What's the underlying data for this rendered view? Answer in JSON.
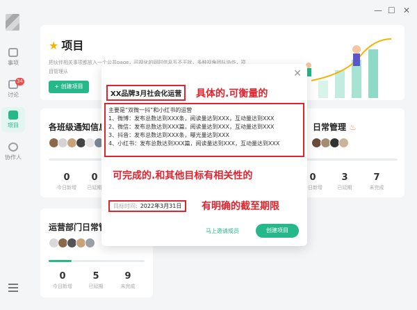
{
  "window": {
    "min": "—",
    "max": "☐",
    "close": "✕"
  },
  "sidebar": {
    "items": [
      {
        "label": "事项"
      },
      {
        "label": "讨论",
        "badge": "34"
      },
      {
        "label": "项目"
      },
      {
        "label": "协作人"
      }
    ]
  },
  "banner": {
    "title": "项目",
    "desc": "把伙伴相关事项都放入一个公共page，可视化的同时信息互不干扰，多种视角团队协作，项目管理从",
    "create_label": "+ 创建项目"
  },
  "cards": [
    {
      "title": "各班级通知信息",
      "stats": [
        {
          "n": "0",
          "t": "今日新增"
        },
        {
          "n": "0",
          "t": "已延期"
        }
      ]
    },
    {
      "title": "日常管理",
      "stats": [
        {
          "n": "0",
          "t": "今日新增"
        },
        {
          "n": "3",
          "t": "已延期"
        },
        {
          "n": "7",
          "t": "未完成"
        }
      ]
    },
    {
      "title": "运营部门日常管",
      "stats": [
        {
          "n": "0",
          "t": "今日新增"
        },
        {
          "n": "5",
          "t": "已延期"
        },
        {
          "n": "9",
          "t": "未完成"
        }
      ]
    }
  ],
  "modal": {
    "title": "XX品牌3月社会化运营",
    "content": [
      "主要是“双微一抖”和小红书的运营",
      "1、微博：发布总数达到XXX条，阅读量达到XXX，互动量达到XXX",
      "2、微信：发布总数达到XXX篇，阅读量达到XXX，互动量达到XXX",
      "3、抖音：发布总数达到XXX条，曝光量达到XXX",
      "4、小红书：发布总数达到XXX篇，阅读量达到XXX，互动量达到XXX"
    ],
    "date_label": "目标时间:",
    "date_value": "2022年3月31日",
    "invite_label": "马上邀请成员",
    "create_label": "创建项目"
  },
  "annotations": {
    "specific": "具体的.可衡量的",
    "achievable": "可完成的.和其他目标有相关性的",
    "deadline": "有明确的截至期限"
  },
  "colors": {
    "accent": "#27b88a",
    "annotation": "#e0232e"
  }
}
